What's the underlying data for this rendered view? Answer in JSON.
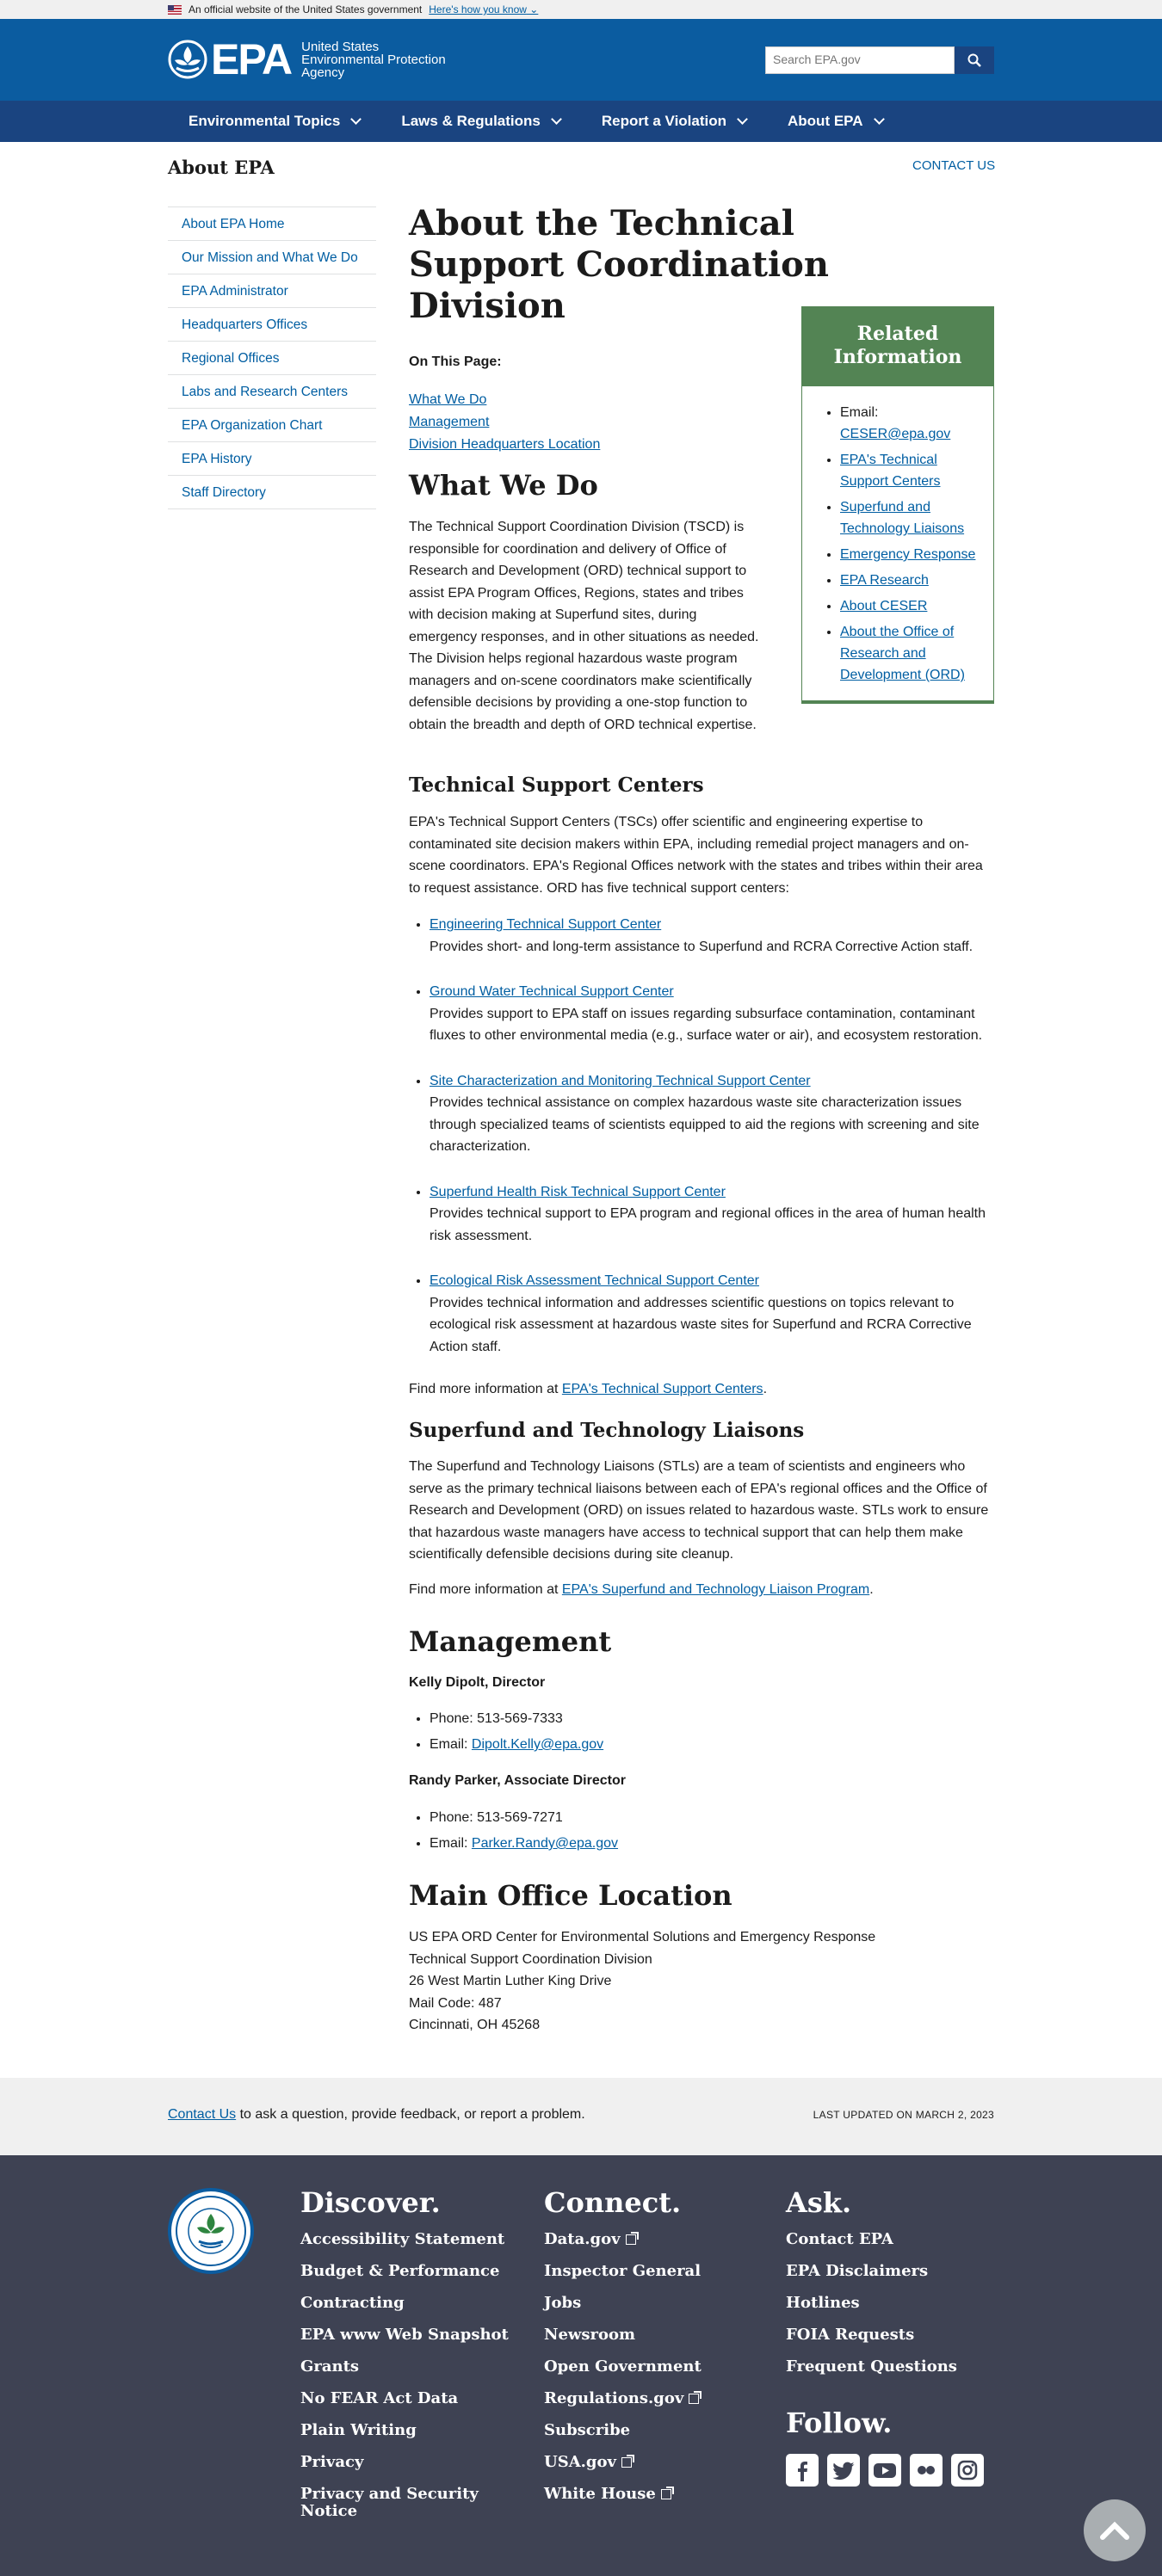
{
  "gov_banner": {
    "text": "An official website of the United States government",
    "link": "Here's how you know"
  },
  "header": {
    "logo_text": "EPA",
    "agency_name": "United States Environmental Protection Agency",
    "search_placeholder": "Search EPA.gov"
  },
  "nav": [
    {
      "label": "Environmental Topics"
    },
    {
      "label": "Laws & Regulations"
    },
    {
      "label": "Report a Violation"
    },
    {
      "label": "About EPA"
    }
  ],
  "section": {
    "title": "About EPA",
    "contact": "CONTACT US"
  },
  "sidebar": [
    "About EPA Home",
    "Our Mission and What We Do",
    "EPA Administrator",
    "Headquarters Offices",
    "Regional Offices",
    "Labs and Research Centers",
    "EPA Organization Chart",
    "EPA History",
    "Staff Directory"
  ],
  "main": {
    "title": "About the Technical Support Coordination Division",
    "on_this_page": "On This Page:",
    "otp_links": [
      "What We Do",
      "Management",
      "Division Headquarters Location"
    ],
    "related": {
      "heading": "Related Information",
      "email_label": "Email: ",
      "email": "CESER@epa.gov",
      "links": [
        "EPA's Technical Support Centers",
        "Superfund and Technology Liaisons",
        "Emergency Response",
        "EPA Research",
        "About CESER",
        "About the Office of Research and Development (ORD)"
      ]
    },
    "what_we_do": {
      "heading": "What We Do",
      "para": "The Technical Support Coordination Division (TSCD) is responsible for coordination and delivery of Office of Research and Development (ORD) technical support to assist EPA Program Offices, Regions, states and tribes with decision making at Superfund sites, during emergency responses, and in other situations as needed. The Division helps regional hazardous waste program managers and on-scene coordinators make scientifically defensible decisions by providing a one-stop function to obtain the breadth and depth of ORD technical expertise."
    },
    "tsc": {
      "heading": "Technical Support Centers",
      "para": "EPA's Technical Support Centers (TSCs) offer scientific and engineering expertise to contaminated site decision makers within EPA, including remedial project managers and on-scene coordinators. EPA's Regional Offices network with the states and tribes within their area to request assistance. ORD has five technical support centers:",
      "centers": [
        {
          "name": "Engineering Technical Support Center",
          "desc": "Provides short- and long-term assistance to Superfund and RCRA Corrective Action staff."
        },
        {
          "name": "Ground Water Technical Support Center",
          "desc": "Provides support to EPA staff on issues regarding subsurface contamination, contaminant fluxes to other environmental media (e.g., surface water or air), and ecosystem restoration."
        },
        {
          "name": "Site Characterization and Monitoring Technical Support Center",
          "desc": "Provides technical assistance on complex hazardous waste site characterization issues through specialized teams of scientists equipped to aid the regions with screening and site characterization."
        },
        {
          "name": "Superfund Health Risk Technical Support Center",
          "desc": "Provides technical support to EPA program and regional offices in the area of human health risk assessment."
        },
        {
          "name": "Ecological Risk Assessment Technical Support Center",
          "desc": "Provides technical information and addresses scientific questions on topics relevant to ecological risk assessment at hazardous waste sites for Superfund and RCRA Corrective Action staff."
        }
      ],
      "more_prefix": "Find more information at ",
      "more_link": "EPA's Technical Support Centers",
      "more_suffix": "."
    },
    "stl": {
      "heading": "Superfund and Technology Liaisons",
      "para": "The Superfund and Technology Liaisons (STLs) are a team of scientists and engineers who serve as the primary technical liaisons between each of EPA's regional offices and the Office of Research and Development (ORD) on issues related to hazardous waste. STLs work to ensure that hazardous waste managers have access to technical support that can help them make scientifically defensible decisions during site cleanup.",
      "more_prefix": "Find more information at ",
      "more_link": "EPA's Superfund and Technology Liaison Program",
      "more_suffix": "."
    },
    "management": {
      "heading": "Management",
      "people": [
        {
          "name": "Kelly Dipolt, Director",
          "phone": "Phone: 513-569-7333",
          "email_label": "Email: ",
          "email": "Dipolt.Kelly@epa.gov"
        },
        {
          "name": "Randy Parker, Associate Director",
          "phone": "Phone: 513-569-7271",
          "email_label": "Email: ",
          "email": "Parker.Randy@epa.gov"
        }
      ]
    },
    "office": {
      "heading": "Main Office Location",
      "lines": [
        "US EPA ORD Center for Environmental Solutions and Emergency Response",
        "Technical Support Coordination Division",
        "26 West Martin Luther King Drive",
        "Mail Code: 487",
        "Cincinnati, OH 45268"
      ]
    }
  },
  "footer_bar": {
    "link": "Contact Us",
    "text": " to ask a question, provide feedback, or report a problem.",
    "updated": "LAST UPDATED ON MARCH 2, 2023"
  },
  "footer": {
    "discover": {
      "heading": "Discover.",
      "links": [
        "Accessibility Statement",
        "Budget & Performance",
        "Contracting",
        "EPA www Web Snapshot",
        "Grants",
        "No FEAR Act Data",
        "Plain Writing",
        "Privacy",
        "Privacy and Security Notice"
      ]
    },
    "connect": {
      "heading": "Connect.",
      "links": [
        "Data.gov",
        "Inspector General",
        "Jobs",
        "Newsroom",
        "Open Government",
        "Regulations.gov",
        "Subscribe",
        "USA.gov",
        "White House"
      ]
    },
    "ask": {
      "heading": "Ask.",
      "links": [
        "Contact EPA",
        "EPA Disclaimers",
        "Hotlines",
        "FOIA Requests",
        "Frequent Questions"
      ]
    },
    "follow": "Follow.",
    "social_icons": [
      "facebook-icon",
      "twitter-icon",
      "youtube-icon",
      "flickr-icon",
      "instagram-icon"
    ]
  },
  "colors": {
    "header_blue": "#0b5ca0",
    "nav_blue": "#1a4480",
    "related_green": "#538454",
    "link": "#005ea2",
    "footer_dark": "#3e4253"
  }
}
